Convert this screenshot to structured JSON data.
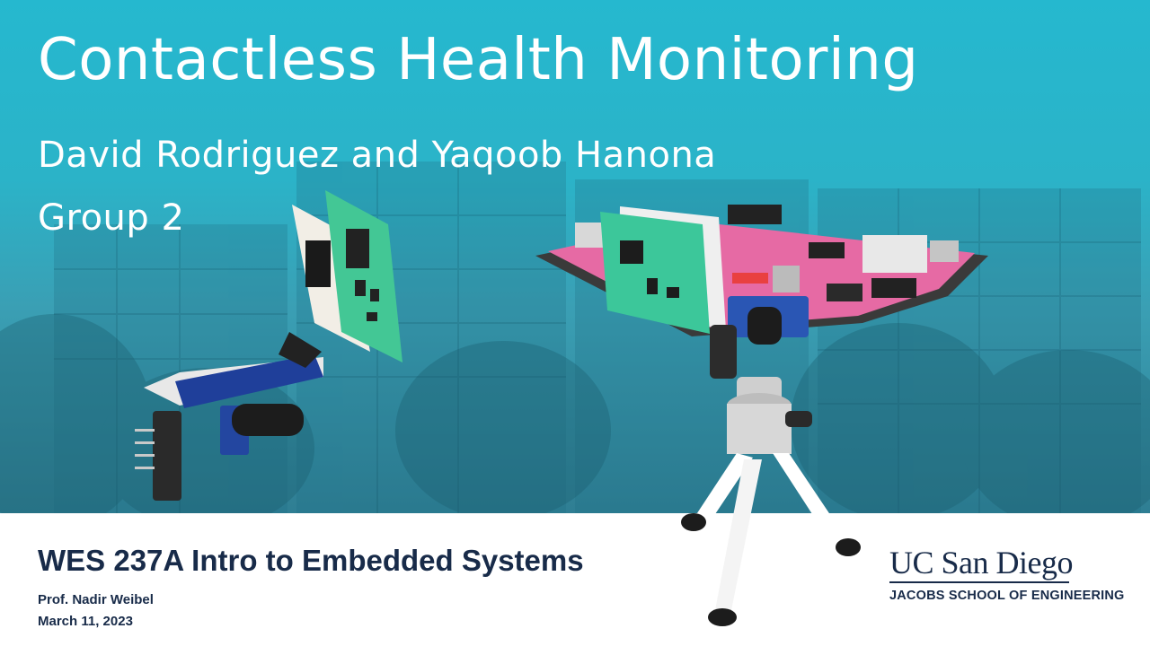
{
  "slide": {
    "title": "Contactless Health Monitoring",
    "authors": "David Rodriguez and Yaqoob Hanona",
    "group": "Group 2"
  },
  "footer": {
    "course": "WES 237A Intro to Embedded Systems",
    "professor": "Prof. Nadir Weibel",
    "date": "March 11, 2023"
  },
  "logo": {
    "name": "UC San Diego",
    "school": "JACOBS SCHOOL OF ENGINEERING"
  },
  "colors": {
    "background_teal": "#25b8cf",
    "navy": "#182b49",
    "board_pink": "#e86aa8",
    "sensor_green": "#3cc79a"
  }
}
